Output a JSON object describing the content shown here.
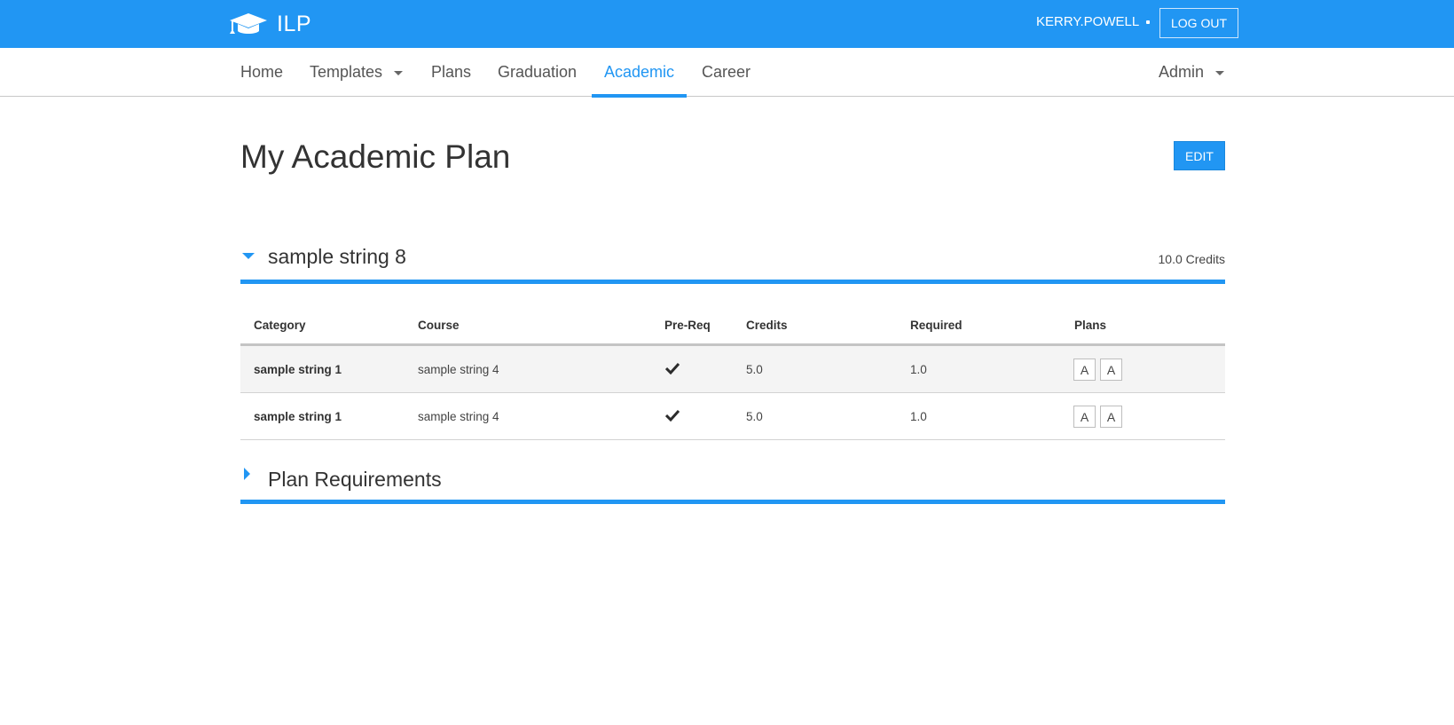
{
  "app": {
    "brand_icon": "graduation-cap-icon",
    "name": "ILP",
    "username": "KERRY.POWELL",
    "logout_label": "LOG OUT",
    "accent_color": "#2196f3"
  },
  "nav": {
    "items": [
      {
        "label": "Home",
        "has_dropdown": false
      },
      {
        "label": "Templates",
        "has_dropdown": true
      },
      {
        "label": "Plans",
        "has_dropdown": false
      },
      {
        "label": "Graduation",
        "has_dropdown": false
      },
      {
        "label": "Academic",
        "has_dropdown": false,
        "active": true
      },
      {
        "label": "Career",
        "has_dropdown": false
      }
    ],
    "admin_label": "Admin"
  },
  "page": {
    "title": "My Academic Plan",
    "edit_label": "EDIT"
  },
  "sections": [
    {
      "title": "sample string 8",
      "credits": "10.0 Credits",
      "expanded": true,
      "table": {
        "headers": [
          "Category",
          "Course",
          "Pre-Req",
          "Credits",
          "Required",
          "Plans"
        ],
        "rows": [
          {
            "category": "sample string 1",
            "course": "sample string 4",
            "prereq": true,
            "credits": "5.0",
            "required": "1.0",
            "plans": [
              "A",
              "A"
            ]
          },
          {
            "category": "sample string 1",
            "course": "sample string 4",
            "prereq": true,
            "credits": "5.0",
            "required": "1.0",
            "plans": [
              "A",
              "A"
            ]
          }
        ]
      }
    },
    {
      "title": "Plan Requirements",
      "expanded": false
    }
  ]
}
